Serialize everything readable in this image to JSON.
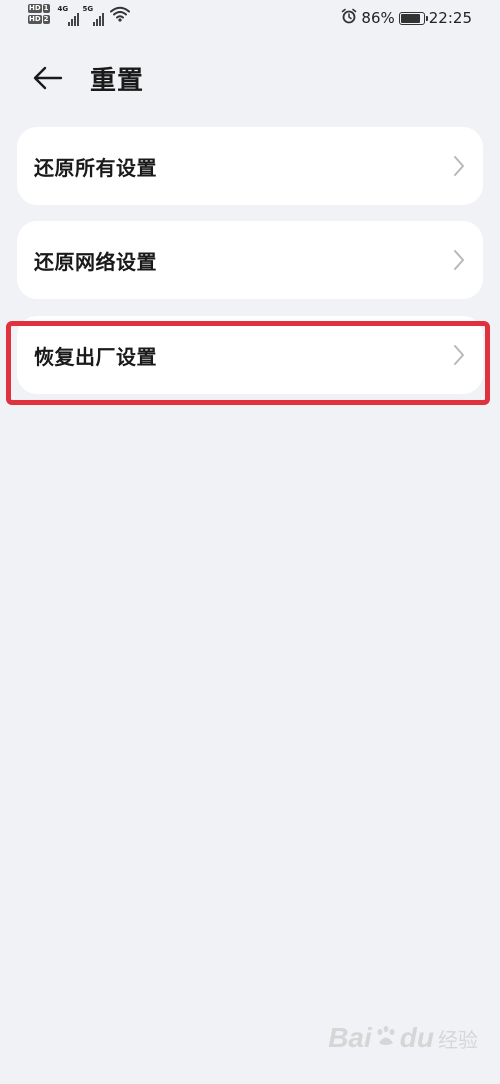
{
  "status_bar": {
    "sim1_tag": "HD",
    "sim1_num": "1",
    "sim2_tag": "HD",
    "sim2_num": "2",
    "net1": "4G",
    "net2": "5G",
    "battery_percent": "86%",
    "battery_level": 0.86,
    "time": "22:25",
    "icons": [
      "signal-icon",
      "wifi-icon",
      "alarm-icon",
      "battery-icon"
    ]
  },
  "header": {
    "title": "重置",
    "back_icon": "back-arrow-icon"
  },
  "items": [
    {
      "label": "还原所有设置"
    },
    {
      "label": "还原网络设置"
    },
    {
      "label": "恢复出厂设置"
    }
  ],
  "highlight_color": "#e0313f",
  "watermark": {
    "brand_left": "Bai",
    "brand_right": "du",
    "sub": "经验"
  }
}
